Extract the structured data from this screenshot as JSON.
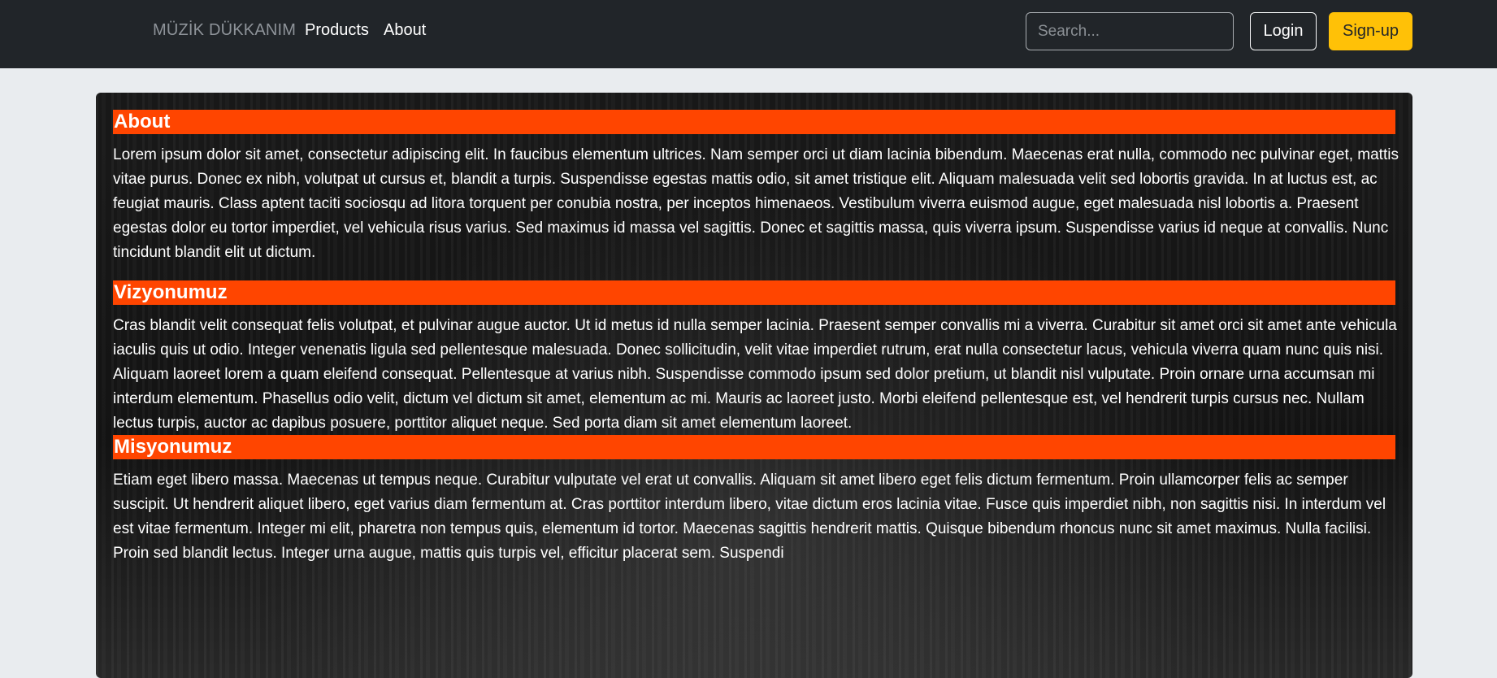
{
  "navbar": {
    "brand": "MÜZİK DÜKKANIM",
    "links": [
      "Products",
      "About"
    ],
    "search_placeholder": "Search...",
    "login_label": "Login",
    "signup_label": "Sign-up"
  },
  "colors": {
    "navbar_bg": "#212529",
    "accent_orange": "#ff4500",
    "signup_yellow": "#ffc107",
    "page_bg": "#e9ecef"
  },
  "sections": [
    {
      "title": "About",
      "text": "Lorem ipsum dolor sit amet, consectetur adipiscing elit. In faucibus elementum ultrices. Nam semper orci ut diam lacinia bibendum. Maecenas erat nulla, commodo nec pulvinar eget, mattis vitae purus. Donec ex nibh, volutpat ut cursus et, blandit a turpis. Suspendisse egestas mattis odio, sit amet tristique elit. Aliquam malesuada velit sed lobortis gravida. In at luctus est, ac feugiat mauris. Class aptent taciti sociosqu ad litora torquent per conubia nostra, per inceptos himenaeos. Vestibulum viverra euismod augue, eget malesuada nisl lobortis a. Praesent egestas dolor eu tortor imperdiet, vel vehicula risus varius. Sed maximus id massa vel sagittis. Donec et sagittis massa, quis viverra ipsum. Suspendisse varius id neque at convallis. Nunc tincidunt blandit elit ut dictum."
    },
    {
      "title": "Vizyonumuz",
      "text": "Cras blandit velit consequat felis volutpat, et pulvinar augue auctor. Ut id metus id nulla semper lacinia. Praesent semper convallis mi a viverra. Curabitur sit amet orci sit amet ante vehicula iaculis quis ut odio. Integer venenatis ligula sed pellentesque malesuada. Donec sollicitudin, velit vitae imperdiet rutrum, erat nulla consectetur lacus, vehicula viverra quam nunc quis nisi. Aliquam laoreet lorem a quam eleifend consequat. Pellentesque at varius nibh. Suspendisse commodo ipsum sed dolor pretium, ut blandit nisl vulputate. Proin ornare urna accumsan mi interdum elementum. Phasellus odio velit, dictum vel dictum sit amet, elementum ac mi. Mauris ac laoreet justo. Morbi eleifend pellentesque est, vel hendrerit turpis cursus nec. Nullam lectus turpis, auctor ac dapibus posuere, porttitor aliquet neque. Sed porta diam sit amet elementum laoreet."
    },
    {
      "title": "Misyonumuz",
      "text": "Etiam eget libero massa. Maecenas ut tempus neque. Curabitur vulputate vel erat ut convallis. Aliquam sit amet libero eget felis dictum fermentum. Proin ullamcorper felis ac semper suscipit. Ut hendrerit aliquet libero, eget varius diam fermentum at. Cras porttitor interdum libero, vitae dictum eros lacinia vitae. Fusce quis imperdiet nibh, non sagittis nisi. In interdum vel est vitae fermentum. Integer mi elit, pharetra non tempus quis, elementum id tortor. Maecenas sagittis hendrerit mattis. Quisque bibendum rhoncus nunc sit amet maximus. Nulla facilisi. Proin sed blandit lectus. Integer urna augue, mattis quis turpis vel, efficitur placerat sem. Suspendi"
    }
  ]
}
